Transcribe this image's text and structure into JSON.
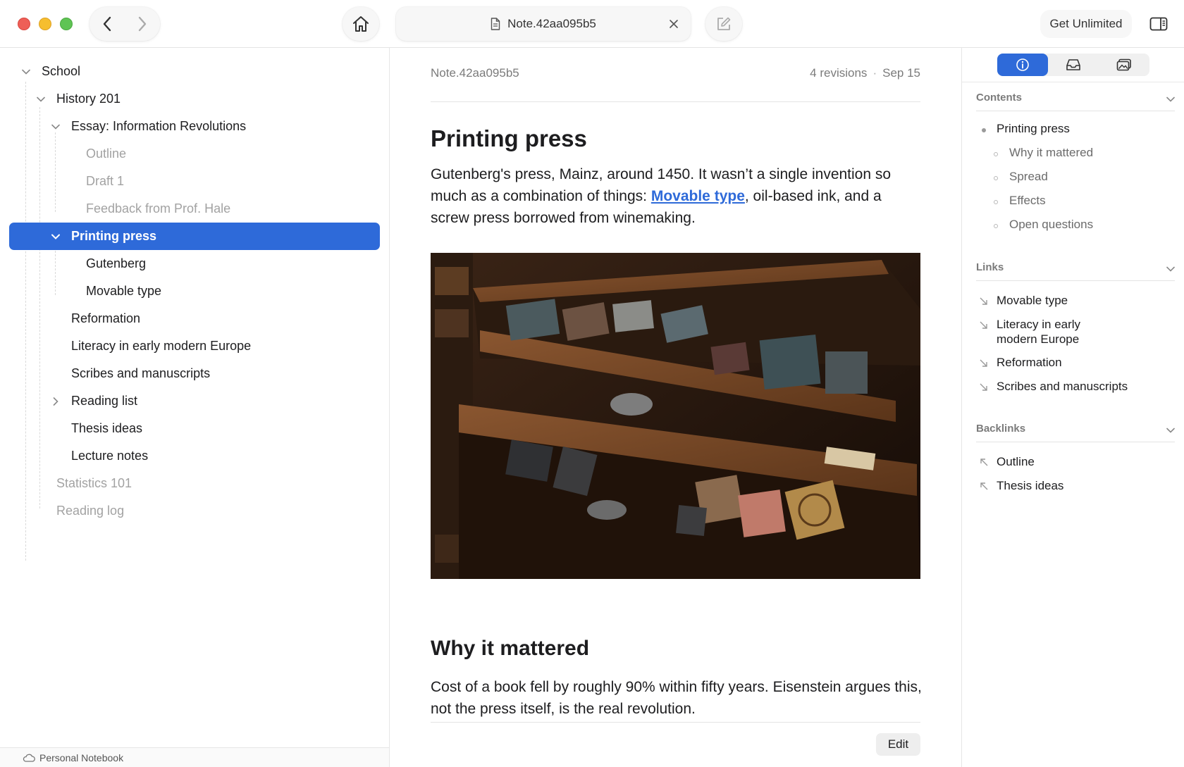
{
  "titlebar": {
    "tab_title": "Note.42aa095b5",
    "get_unlimited_label": "Get Unlimited"
  },
  "sidebar": {
    "items": [
      {
        "label": "School",
        "state": "expanded"
      },
      {
        "label": "History 201",
        "state": "expanded"
      },
      {
        "label": "Essay: Information Revolutions",
        "state": "expanded"
      },
      {
        "label": "Outline",
        "state": "dim"
      },
      {
        "label": "Draft 1",
        "state": "dim"
      },
      {
        "label": "Feedback from Prof. Hale",
        "state": "dim"
      },
      {
        "label": "Printing press",
        "state": "selected"
      },
      {
        "label": "Gutenberg",
        "state": "leaf"
      },
      {
        "label": "Movable type",
        "state": "leaf"
      },
      {
        "label": "Reformation",
        "state": "leaf"
      },
      {
        "label": "Literacy in early modern Europe",
        "state": "leaf"
      },
      {
        "label": "Scribes and manuscripts",
        "state": "leaf"
      },
      {
        "label": "Reading list",
        "state": "collapsed"
      },
      {
        "label": "Thesis ideas",
        "state": "leaf"
      },
      {
        "label": "Lecture notes",
        "state": "leaf"
      },
      {
        "label": "Statistics 101",
        "state": "dim"
      },
      {
        "label": "Reading log",
        "state": "dim"
      }
    ],
    "footer_label": "Personal Notebook"
  },
  "note": {
    "id": "Note.42aa095b5",
    "revisions": "4 revisions",
    "separator": "·",
    "date": "Sep 15",
    "title": "Printing press",
    "intro_part1": "Gutenberg's press, Mainz, around 1450. It wasn’t a single invention so much as a combination of things: ",
    "intro_link": "Movable type",
    "intro_part2": ", oil-based ink, and a screw press borrowed from winemaking.",
    "section_title": "Why it mattered",
    "section_body": "Cost of a book fell by roughly 90% within fifty years. Eisenstein argues this, not the press itself, is the real revolution.",
    "edit_label": "Edit"
  },
  "inspector": {
    "contents_heading": "Contents",
    "contents": [
      {
        "label": "Printing press",
        "level": 1
      },
      {
        "label": "Why it mattered",
        "level": 2
      },
      {
        "label": "Spread",
        "level": 2
      },
      {
        "label": "Effects",
        "level": 2
      },
      {
        "label": "Open questions",
        "level": 2
      }
    ],
    "links_heading": "Links",
    "links": [
      {
        "label": "Movable type"
      },
      {
        "label": "Literacy in early modern Europe"
      },
      {
        "label": "Reformation"
      },
      {
        "label": "Scribes and manuscripts"
      }
    ],
    "backlinks_heading": "Backlinks",
    "backlinks": [
      {
        "label": "Outline"
      },
      {
        "label": "Thesis ideas"
      }
    ]
  },
  "colors": {
    "accent": "#2e6ad9",
    "traffic_close": "#ee5f57",
    "traffic_minimize": "#f6be2f",
    "traffic_maximize": "#5fc454"
  },
  "icons": [
    "back-arrow-icon",
    "forward-arrow-icon",
    "home-icon",
    "document-icon",
    "close-icon",
    "compose-icon",
    "sidebar-toggle-icon",
    "info-icon",
    "inbox-icon",
    "gallery-icon",
    "cloud-icon",
    "chevron-down-icon",
    "chevron-right-icon",
    "outgoing-link-arrow-icon",
    "incoming-link-arrow-icon"
  ]
}
